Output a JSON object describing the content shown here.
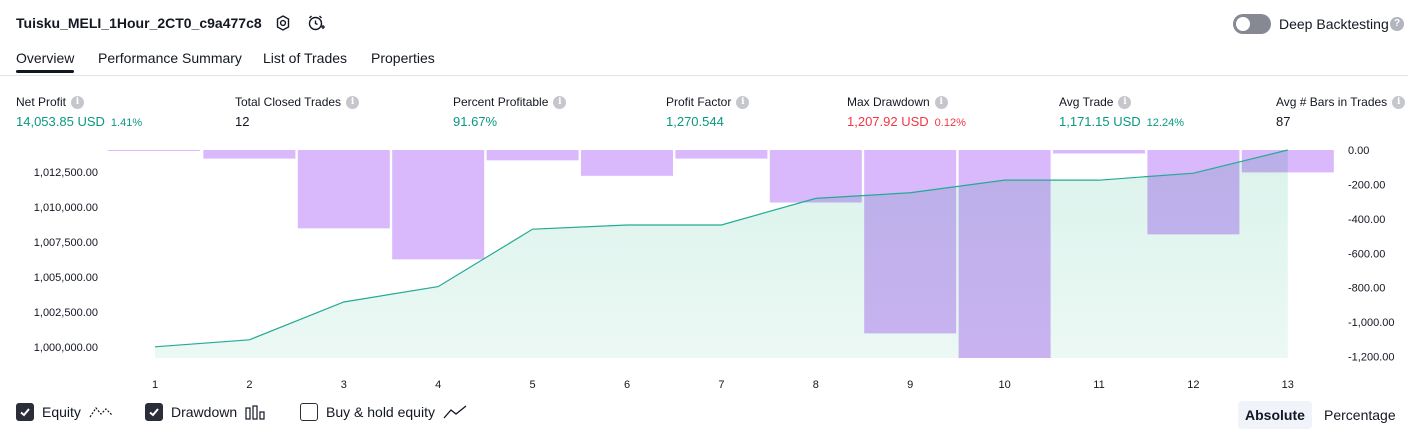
{
  "header": {
    "strategy_title": "Tuisku_MELI_1Hour_2CT0_c9a477c8",
    "deep_backtesting_label": "Deep Backtesting",
    "help_glyph": "?"
  },
  "tabs": [
    {
      "label": "Overview"
    },
    {
      "label": "Performance Summary"
    },
    {
      "label": "List of Trades"
    },
    {
      "label": "Properties"
    }
  ],
  "stats": [
    {
      "label": "Net Profit",
      "value": "14,053.85 USD",
      "pct": "1.41%",
      "color": "green"
    },
    {
      "label": "Total Closed Trades",
      "value": "12",
      "pct": "",
      "color": "dark"
    },
    {
      "label": "Percent Profitable",
      "value": "91.67%",
      "pct": "",
      "color": "green"
    },
    {
      "label": "Profit Factor",
      "value": "1,270.544",
      "pct": "",
      "color": "green"
    },
    {
      "label": "Max Drawdown",
      "value": "1,207.92 USD",
      "pct": "0.12%",
      "color": "red"
    },
    {
      "label": "Avg Trade",
      "value": "1,171.15 USD",
      "pct": "12.24%",
      "color": "green"
    },
    {
      "label": "Avg # Bars in Trades",
      "value": "87",
      "pct": "",
      "color": "dark"
    }
  ],
  "chart_data": {
    "type": "line",
    "x": [
      1,
      2,
      3,
      4,
      5,
      6,
      7,
      8,
      9,
      10,
      11,
      12,
      13
    ],
    "series": [
      {
        "name": "Equity",
        "axis": "left",
        "values": [
          1000000,
          1000500,
          1003200,
          1004300,
          1008400,
          1008700,
          1008700,
          1010600,
          1011000,
          1011900,
          1011900,
          1012400,
          1014054
        ]
      },
      {
        "name": "Drawdown",
        "axis": "right",
        "values": [
          -5,
          -50,
          -455,
          -635,
          -60,
          -150,
          -50,
          -305,
          -1065,
          -1208,
          -20,
          -490,
          -130
        ]
      }
    ],
    "left_axis": {
      "ylim": [
        999200,
        1014054
      ],
      "ticks": [
        "1,000,000.00",
        "1,002,500.00",
        "1,005,000.00",
        "1,007,500.00",
        "1,010,000.00",
        "1,012,500.00"
      ],
      "tick_values": [
        1000000,
        1002500,
        1005000,
        1007500,
        1010000,
        1012500
      ]
    },
    "right_axis": {
      "ylim": [
        -1208,
        0
      ],
      "ticks": [
        "0.00",
        "-200.00",
        "-400.00",
        "-600.00",
        "-800.00",
        "-1,000.00",
        "-1,200.00"
      ],
      "tick_values": [
        0,
        -200,
        -400,
        -600,
        -800,
        -1000,
        -1200
      ]
    },
    "colors": {
      "equity_line": "#22ab94",
      "equity_fill": "#cdeee4",
      "drawdown": "#d9b8fb",
      "overlap": "#b4b4e8"
    }
  },
  "legend": {
    "equity_label": "Equity",
    "drawdown_label": "Drawdown",
    "buy_hold_label": "Buy & hold equity",
    "absolute_label": "Absolute",
    "percentage_label": "Percentage"
  }
}
